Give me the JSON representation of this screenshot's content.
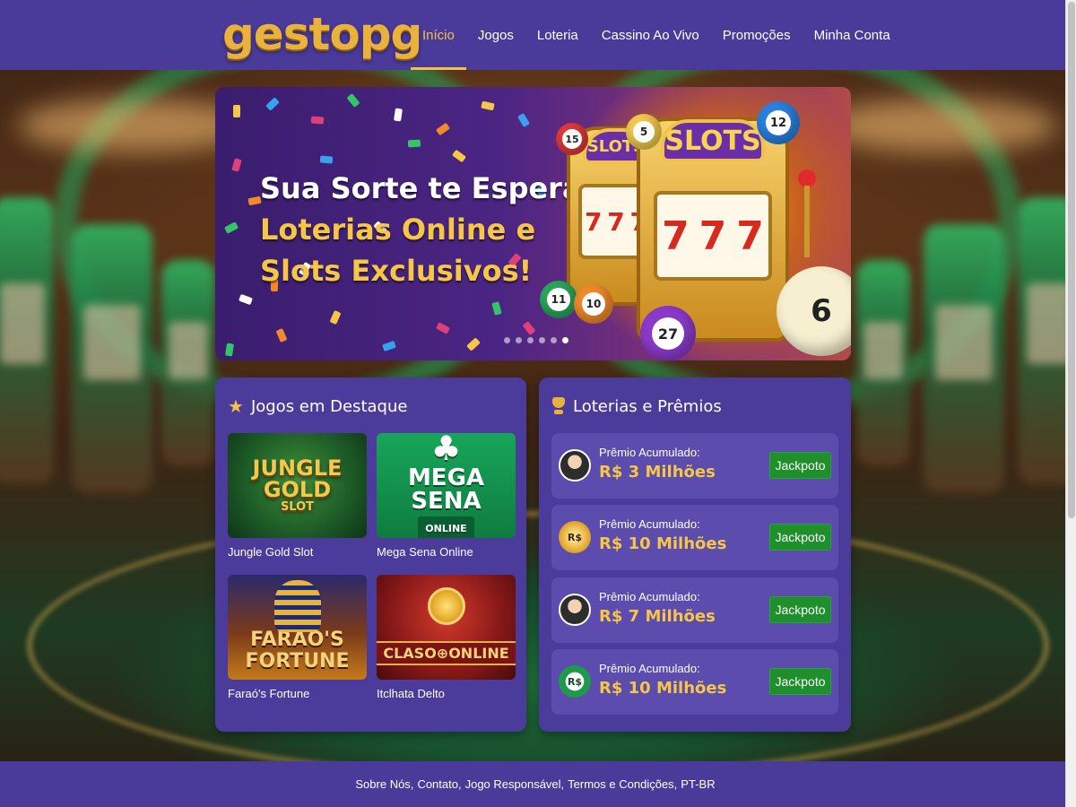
{
  "brand": {
    "logo_text": "gestopg"
  },
  "nav": {
    "items": [
      {
        "label": "Início",
        "active": true
      },
      {
        "label": "Jogos",
        "active": false
      },
      {
        "label": "Loteria",
        "active": false
      },
      {
        "label": "Cassino Ao Vivo",
        "active": false
      },
      {
        "label": "Promoções",
        "active": false
      },
      {
        "label": "Minha Conta",
        "active": false
      }
    ]
  },
  "hero": {
    "line1": "Sua Sorte te Espera!",
    "line2": "Loterias Online e",
    "line3": "Slots Exclusivos!",
    "slot_label": "SLOTS",
    "reel_symbols": [
      "7",
      "7",
      "7"
    ],
    "balls": [
      "15",
      "12",
      "5",
      "11",
      "10",
      "27",
      "6"
    ],
    "carousel_dots": 6,
    "carousel_active_index": 5
  },
  "featured_games": {
    "title": "Jogos em Destaque",
    "icon": "star-icon",
    "items": [
      {
        "name": "Jungle Gold Slot",
        "thumb_text": [
          "JUNGLE",
          "GOLD",
          "SLOT"
        ]
      },
      {
        "name": "Mega Sena Online",
        "thumb_text": [
          "MEGA SENA",
          "ONLINE"
        ]
      },
      {
        "name": "Faraó's Fortune",
        "thumb_text": [
          "FARAÓ'S",
          "FORTUNE"
        ]
      },
      {
        "name": "Itclhata Delto",
        "thumb_text": [
          "CLASO⊕ONLINE"
        ]
      }
    ]
  },
  "lotteries": {
    "title": "Loterias e Prêmios",
    "icon": "trophy-icon",
    "items": [
      {
        "caption": "Prêmio Acumulado:",
        "amount": "R$ 3 Milhões",
        "button": "Jackpoto",
        "avatar": "person"
      },
      {
        "caption": "Prêmio Acumulado:",
        "amount": "R$ 10 Milhões",
        "button": "Jackpoto",
        "avatar": "gold-coin",
        "avatar_text": "R$"
      },
      {
        "caption": "Prêmio Acumulado:",
        "amount": "R$ 7 Milhões",
        "button": "Jackpoto",
        "avatar": "person"
      },
      {
        "caption": "Prêmio Acumulado:",
        "amount": "R$ 10 Milhões",
        "button": "Jackpoto",
        "avatar": "green-ball",
        "avatar_text": "R$"
      }
    ]
  },
  "footer": {
    "links": [
      "Sobre Nós,",
      "Contato,",
      "Jogo Responsável,",
      "Termos e Condições,",
      "PT-BR"
    ]
  },
  "colors": {
    "header_bg": "#4a3a9a",
    "panel_bg": "#4b3c9c",
    "row_bg": "#5b4cae",
    "accent_gold": "#f3c04a",
    "button_green": "#1f8f2c"
  }
}
